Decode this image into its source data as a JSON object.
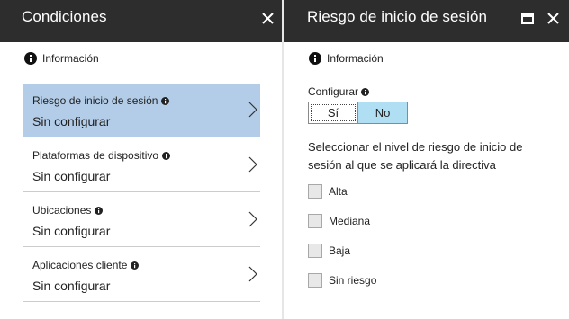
{
  "left_blade": {
    "title": "Condiciones",
    "info_label": "Información",
    "items": [
      {
        "title": "Riesgo de inicio de sesión",
        "value": "Sin configurar",
        "selected": true
      },
      {
        "title": "Plataformas de dispositivo",
        "value": "Sin configurar",
        "selected": false
      },
      {
        "title": "Ubicaciones",
        "value": "Sin configurar",
        "selected": false
      },
      {
        "title": "Aplicaciones cliente",
        "value": "Sin configurar",
        "selected": false
      }
    ]
  },
  "right_blade": {
    "title": "Riesgo de inicio de sesión",
    "info_label": "Información",
    "configure_label": "Configurar",
    "toggle": {
      "options": [
        "Sí",
        "No"
      ],
      "selected": "No"
    },
    "description": "Seleccionar el nivel de riesgo de inicio de sesión al que se aplicará la directiva",
    "risk_levels": [
      {
        "label": "Alta",
        "checked": false
      },
      {
        "label": "Mediana",
        "checked": false
      },
      {
        "label": "Baja",
        "checked": false
      },
      {
        "label": "Sin riesgo",
        "checked": false
      }
    ]
  },
  "icons": {
    "close": "close-icon",
    "maximize": "maximize-icon",
    "info": "info-icon",
    "chevron": "chevron-right-icon"
  },
  "colors": {
    "header_bg": "#2d2d2d",
    "selected_item_bg": "#b3cde8",
    "toggle_selected_bg": "#b0dff3"
  }
}
